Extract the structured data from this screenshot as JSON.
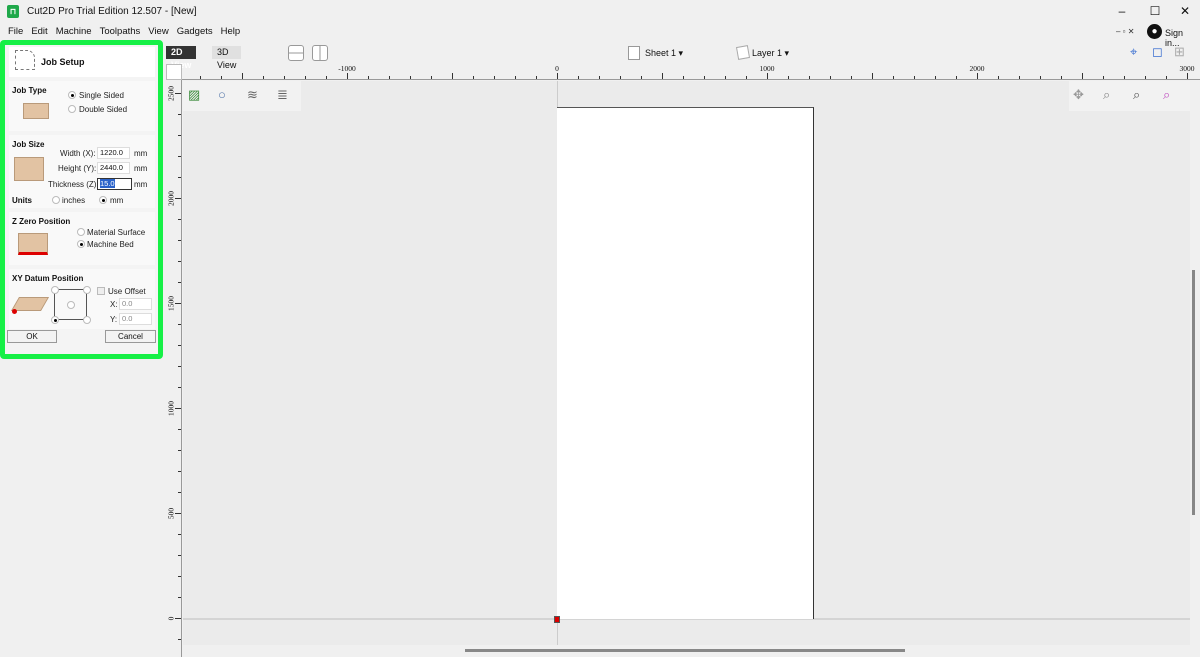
{
  "window": {
    "title": "Cut2D Pro Trial Edition 12.507 - [New]",
    "app_icon": "cut2d-logo",
    "minimize": "–",
    "maximize": "☐",
    "close": "✕",
    "sign_in": "Sign in..."
  },
  "menu": [
    "File",
    "Edit",
    "Machine",
    "Toolpaths",
    "View",
    "Gadgets",
    "Help"
  ],
  "job_setup": {
    "title": "Job Setup",
    "job_type": {
      "label": "Job Type",
      "options": [
        "Single Sided",
        "Double Sided"
      ],
      "selected": "Single Sided"
    },
    "job_size": {
      "label": "Job Size",
      "width_label": "Width (X):",
      "width": "1220.0",
      "height_label": "Height (Y):",
      "height": "2440.0",
      "thickness_label": "Thickness (Z):",
      "thickness": "15.0",
      "unit": "mm"
    },
    "units": {
      "label": "Units",
      "options": [
        "inches",
        "mm"
      ],
      "selected": "mm"
    },
    "z_zero": {
      "label": "Z Zero Position",
      "options": [
        "Material Surface",
        "Machine Bed"
      ],
      "selected": "Machine Bed"
    },
    "xy_datum": {
      "label": "XY Datum Position",
      "use_offset": "Use Offset",
      "use_offset_checked": false,
      "x_label": "X:",
      "x": "0.0",
      "y_label": "Y:",
      "y": "0.0"
    },
    "ok": "OK",
    "cancel": "Cancel"
  },
  "view_tabs": [
    "2D View",
    "3D View"
  ],
  "active_view": "2D View",
  "sheet": "Sheet 1 ▾",
  "layer": "Layer 1 ▾",
  "ruler": {
    "x_labels": [
      "-1000",
      "0",
      "1000",
      "2000",
      "3000"
    ],
    "y_labels": [
      "2500",
      "2000",
      "1500",
      "1000",
      "500",
      "0"
    ]
  },
  "colors": {
    "highlight": "#16f046",
    "origin": "#dd0000",
    "accent": "#3b6fd1"
  }
}
